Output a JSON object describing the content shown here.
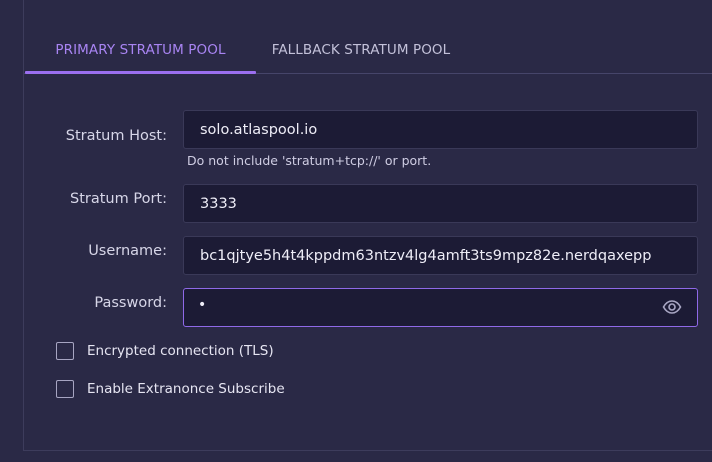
{
  "tabs": [
    {
      "label": "PRIMARY STRATUM POOL",
      "active": true
    },
    {
      "label": "FALLBACK STRATUM POOL",
      "active": false
    }
  ],
  "form": {
    "host": {
      "label": "Stratum Host:",
      "value": "solo.atlaspool.io",
      "hint": "Do not include 'stratum+tcp://' or port."
    },
    "port": {
      "label": "Stratum Port:",
      "value": "3333"
    },
    "username": {
      "label": "Username:",
      "value": "bc1qjtye5h4t4kppdm63ntzv4lg4amft3ts9mpz82e.nerdqaxepp"
    },
    "password": {
      "label": "Password:",
      "value": "•",
      "visibility_icon": "eye-icon"
    }
  },
  "options": [
    {
      "label": "Encrypted connection (TLS)",
      "checked": false
    },
    {
      "label": "Enable Extranonce Subscribe",
      "checked": false
    }
  ],
  "colors": {
    "background": "#2a2946",
    "accent": "#9b6ff0",
    "field_background": "#1c1b35"
  }
}
